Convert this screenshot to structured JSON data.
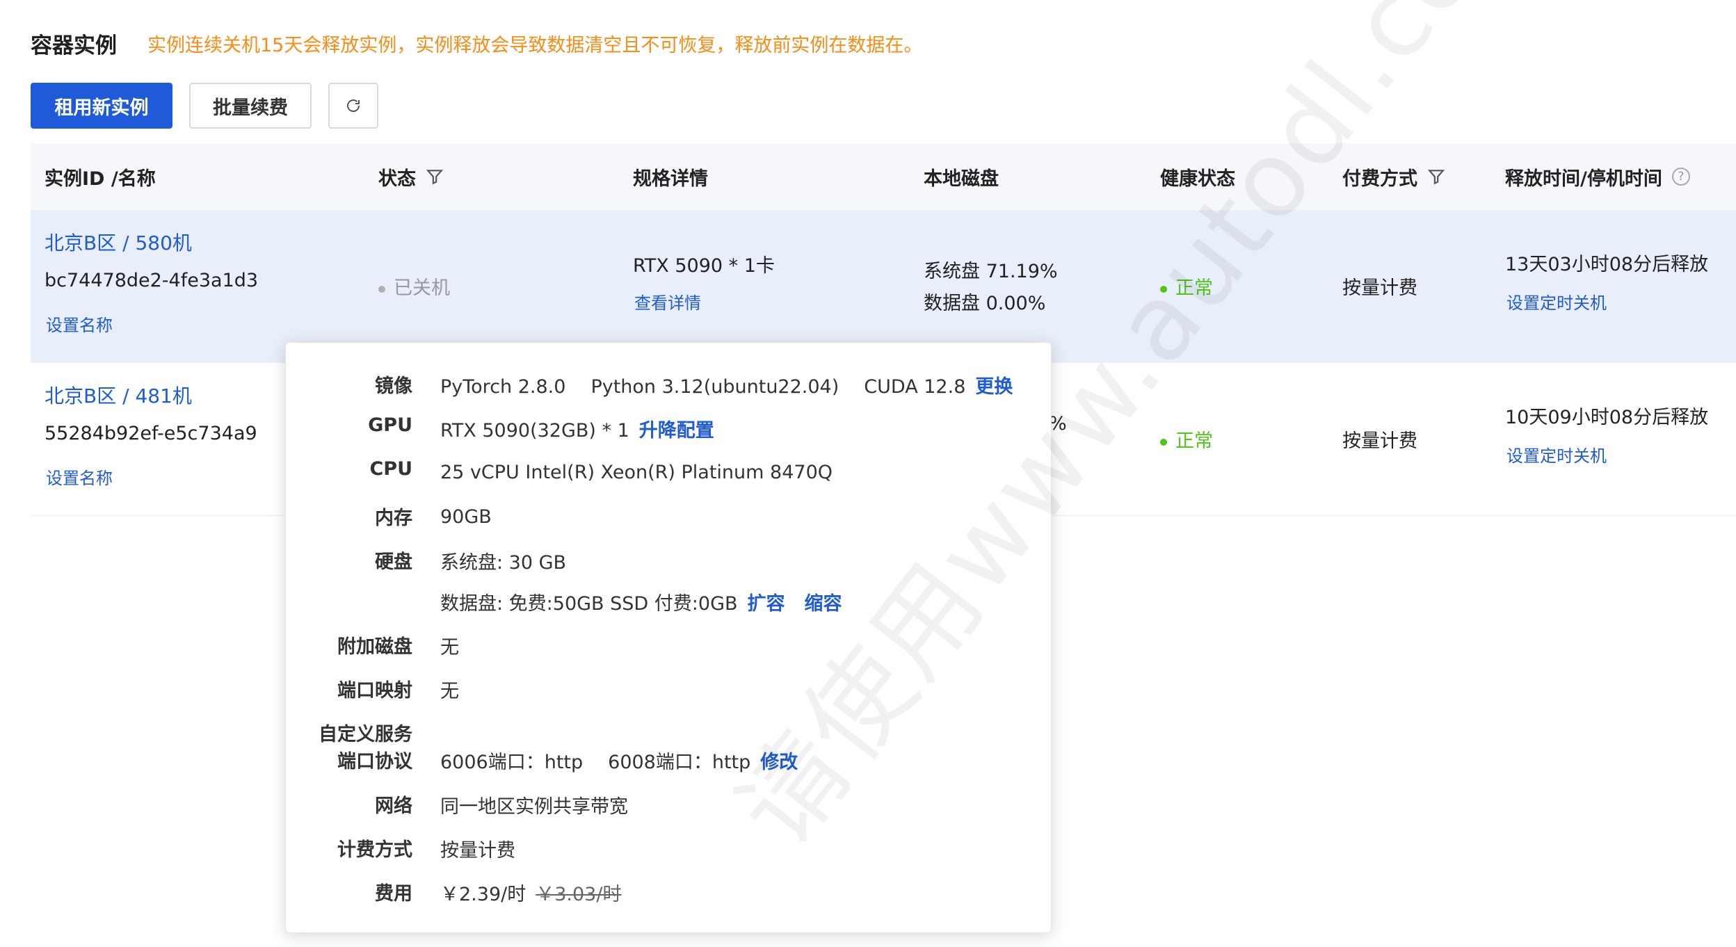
{
  "header": {
    "title": "容器实例",
    "notice": "实例连续关机15天会释放实例，实例释放会导致数据清空且不可恢复，释放前实例在数据在。"
  },
  "toolbar": {
    "rent_label": "租用新实例",
    "renew_label": "批量续费",
    "refresh_icon": "refresh-icon"
  },
  "table": {
    "columns": [
      "实例ID /名称",
      "状态",
      "规格详情",
      "本地磁盘",
      "健康状态",
      "付费方式",
      "释放时间/停机时间"
    ],
    "rows": [
      {
        "name": "北京B区 / 580机",
        "id": "bc74478de2-4fe3a1d3",
        "set_name": "设置名称",
        "status": "已关机",
        "spec": "RTX 5090 * 1卡",
        "spec_link": "查看详情",
        "disk_sys": "系统盘 71.19%",
        "disk_data": "数据盘 0.00%",
        "health": "正常",
        "billing": "按量计费",
        "release": "13天03小时08分后释放",
        "release_link": "设置定时关机"
      },
      {
        "name": "北京B区 / 481机",
        "id": "55284b92ef-e5c734a9",
        "set_name": "设置名称",
        "disk_partial": "%",
        "health": "正常",
        "billing": "按量计费",
        "release": "10天09小时08分后释放",
        "release_link": "设置定时关机"
      }
    ]
  },
  "popover": {
    "image": {
      "label": "镜像",
      "pytorch": "PyTorch  2.8.0",
      "python": "Python  3.12(ubuntu22.04)",
      "cuda": "CUDA  12.8",
      "link": "更换"
    },
    "gpu": {
      "label": "GPU",
      "value": "RTX 5090(32GB) * 1",
      "link": "升降配置"
    },
    "cpu": {
      "label": "CPU",
      "value": "25 vCPU Intel(R) Xeon(R) Platinum 8470Q"
    },
    "memory": {
      "label": "内存",
      "value": "90GB"
    },
    "disk": {
      "label": "硬盘",
      "sys": "系统盘:  30 GB",
      "data": "数据盘:  免费:50GB SSD  付费:0GB",
      "expand": "扩容",
      "shrink": "缩容"
    },
    "extra_disk": {
      "label": "附加磁盘",
      "value": "无"
    },
    "port_map": {
      "label": "端口映射",
      "value": "无"
    },
    "custom_service": {
      "label_line1": "自定义服务",
      "label_line2": "端口协议",
      "p1": "6006端口：http",
      "p2": "6008端口：http",
      "link": "修改"
    },
    "network": {
      "label": "网络",
      "value": "同一地区实例共享带宽"
    },
    "billing": {
      "label": "计费方式",
      "value": "按量计费"
    },
    "fee": {
      "label": "费用",
      "price": "￥2.39/时",
      "original": "￥3.03/时"
    }
  },
  "watermark": "请使用www.autodl.com",
  "colors": {
    "primary": "#1f5bd8",
    "notice": "#fa8c16",
    "ok": "#52c41a",
    "highlight_row": "#e9eefb"
  }
}
